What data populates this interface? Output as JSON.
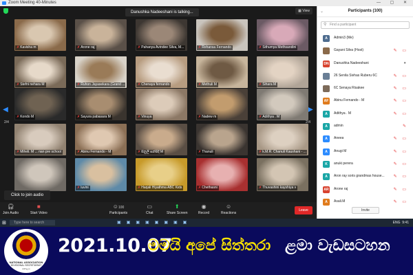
{
  "window": {
    "title": "Zoom Meeting 40-Minutes",
    "controls": "— ▢ ✕"
  },
  "meeting": {
    "talking": "Danushka Nadeeshani is talking...",
    "view_label": "View",
    "page_left": "2/4",
    "page_right": "2/4",
    "join_popup": "Click to join audio"
  },
  "tiles": [
    {
      "name": "Kavisha m",
      "c1": "#8a6a4a",
      "c2": "#d9c7b0"
    },
    {
      "name": "Arone raj",
      "c1": "#5a5048",
      "c2": "#c9b39a"
    },
    {
      "name": "Pahanya Avindee Silva, M...",
      "c1": "#3d3732",
      "c2": "#9b8777"
    },
    {
      "name": "Rehansa Fernando",
      "c1": "#c9c4bd",
      "c2": "#7a5a3a"
    },
    {
      "name": "Sithumya Methsandini",
      "c1": "#6b5a64",
      "c2": "#d8a9b8"
    },
    {
      "name": "Stefni nehara M",
      "c1": "#7a6a58",
      "c2": "#e6d9c9"
    },
    {
      "name": "Ruhon Jayasekara (Grand ...",
      "c1": "#d8d2c8",
      "c2": "#9a7b58"
    },
    {
      "name": "Chenaya fernando",
      "c1": "#b79c80",
      "c2": "#e9ddd0"
    },
    {
      "name": "Methuli M",
      "c1": "#c7b59c",
      "c2": "#6f5a44"
    },
    {
      "name": "Sihara M",
      "c1": "#b0a497",
      "c2": "#e3d3c3"
    },
    {
      "name": "Kondo M",
      "c1": "#2a2a2a",
      "c2": "#6f6252"
    },
    {
      "name": "Sayura pabasara M",
      "c1": "#3a342e",
      "c2": "#a88d70"
    },
    {
      "name": "Vinuya",
      "c1": "#8c7865",
      "c2": "#dccbb9"
    },
    {
      "name": "Nadew m",
      "c1": "#4a4038",
      "c2": "#c29c6e"
    },
    {
      "name": "Adithya . M",
      "c1": "#7f7a73",
      "c2": "#d2c9bd"
    },
    {
      "name": "Miheli. M ... nan pre school",
      "c1": "#918271",
      "c2": "#d8cbbd"
    },
    {
      "name": "Abinu Fernando - M",
      "c1": "#8b6f55",
      "c2": "#dfc8b1"
    },
    {
      "name": "සිනුලි සන්සිදි M",
      "c1": "#5a4e44",
      "c2": "#c9ab8c"
    },
    {
      "name": "Thanuli",
      "c1": "#3a3430",
      "c2": "#b9a48d"
    },
    {
      "name": "k.M.R. Chanuli Kaushani - ...",
      "c1": "#a89886",
      "c2": "#ddd0c1"
    },
    {
      "name": "",
      "c1": "#6f6a64",
      "c2": "#cfc6bb"
    },
    {
      "name": "luvini",
      "c1": "#5e8aa8",
      "c2": "#d9c0a0"
    },
    {
      "name": "Harjali Hiyathma ABC Kids",
      "c1": "#c79a2a",
      "c2": "#e8cf88"
    },
    {
      "name": "Chethasni",
      "c1": "#a83030",
      "c2": "#e7b0b0"
    },
    {
      "name": "Thuvashini kayshiya v",
      "c1": "#7a7060",
      "c2": "#d3c5b3"
    }
  ],
  "toolbar": {
    "join_audio": "Join Audio",
    "start_video": "Start Video",
    "participants": "Participants",
    "participants_count": "100",
    "chat": "Chat",
    "share": "Share Screen",
    "record": "Record",
    "reactions": "Reactions",
    "leave": "Leave"
  },
  "panel": {
    "title": "Participants (100)",
    "search_placeholder": "Find a participant",
    "invite": "Invite",
    "items": [
      {
        "initials": "A",
        "color": "#4f6d8f",
        "name": "Admin3 (Me)",
        "icons": ""
      },
      {
        "initials": "",
        "color": "#8a6a4a",
        "name": "Gayani Silva (Host)",
        "icons": "✎ ▭"
      },
      {
        "initials": "DN",
        "color": "#d8432f",
        "name": "Danushka Nadeeshani",
        "icons": "●"
      },
      {
        "initials": "",
        "color": "#6a7f96",
        "name": "26 Senila Sivhas Ruberu 6C",
        "icons": "✎ ▭"
      },
      {
        "initials": "",
        "color": "#7d6b5a",
        "name": "6C Senaya Risakee",
        "icons": "✎ ▭"
      },
      {
        "initials": "AF",
        "color": "#e07b1c",
        "name": "Abinu Fernando - M",
        "icons": "✎ ▭"
      },
      {
        "initials": "A",
        "color": "#1aa6a6",
        "name": "Adithya . M",
        "icons": "✎ ▭"
      },
      {
        "initials": "A",
        "color": "#1aa6a6",
        "name": "admin",
        "icons": "✎"
      },
      {
        "initials": "A",
        "color": "#2d8cff",
        "name": "Aneea",
        "icons": "✎ ▭"
      },
      {
        "initials": "A",
        "color": "#2d8cff",
        "name": "Anugi M",
        "icons": "✎ ▭"
      },
      {
        "initials": "K",
        "color": "#1aa6a6",
        "name": "anuki perera",
        "icons": "✎ ▭"
      },
      {
        "initials": "A",
        "color": "#1aa6a6",
        "name": "Aron ray soris grandmas house...",
        "icons": "✎ ▭"
      },
      {
        "initials": "AR",
        "color": "#d8432f",
        "name": "Arone raj",
        "icons": "✎ ▭"
      },
      {
        "initials": "A",
        "color": "#e07b1c",
        "name": "Asali.M",
        "icons": "✎ ▭"
      }
    ]
  },
  "taskbar": {
    "search_placeholder": "Type here to search",
    "tray": "ENG",
    "time": "9:41"
  },
  "banner": {
    "date": "2021.10.07",
    "title1": "මමයි අපේ සිත්තරා",
    "title2": "ළමා වැඩසටහන",
    "seal_line1": "NATIONAL ASSOCIATION",
    "seal_line2": "DIVISIONAL SECRETARIAT",
    "seal_line3": "කොළඹ"
  }
}
